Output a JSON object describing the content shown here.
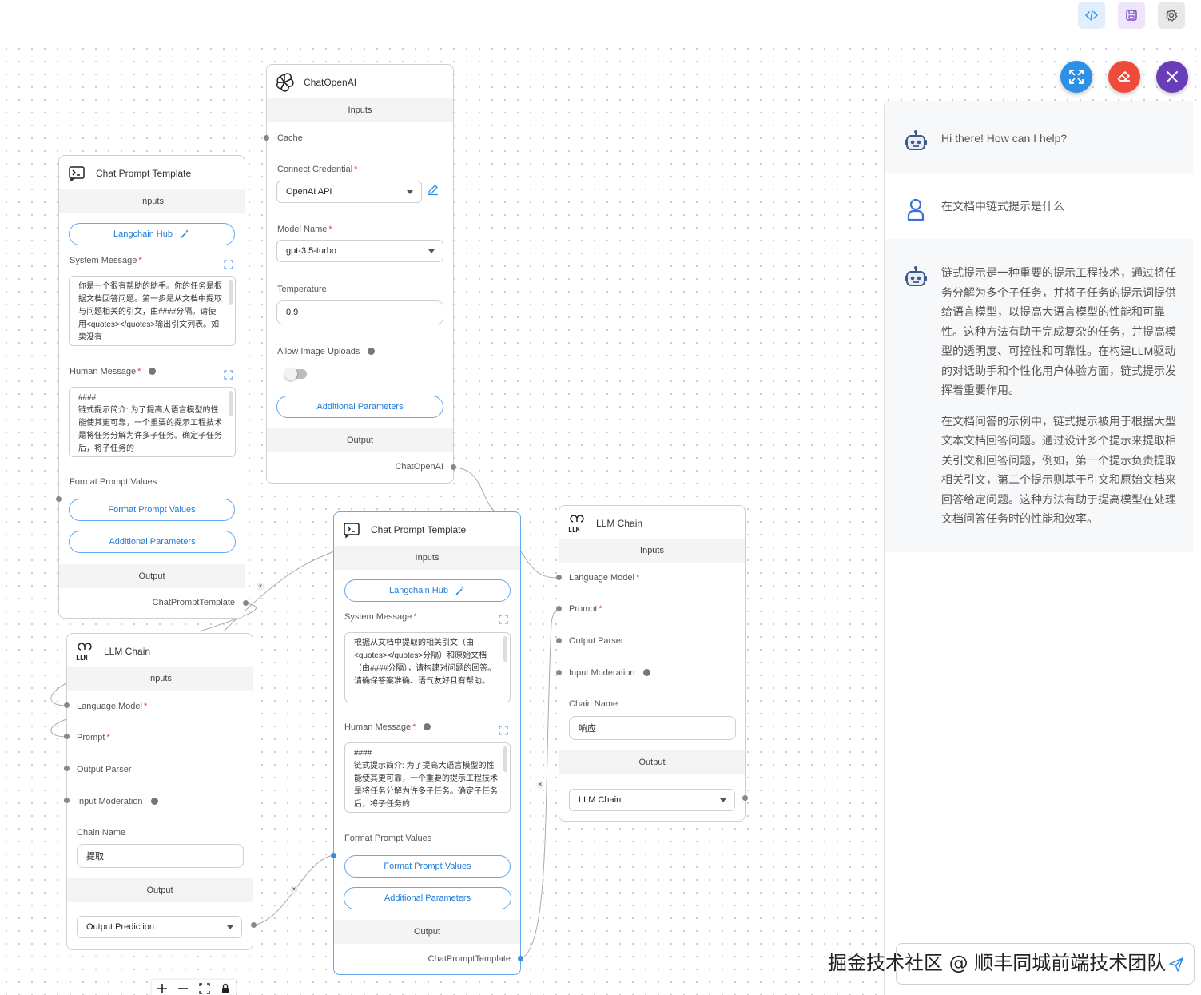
{
  "icons": {
    "code": "code-icon",
    "save": "save-icon",
    "settings": "gear-icon",
    "expand": "expand-icon",
    "eraser": "eraser-icon",
    "close": "close-icon",
    "send": "send-icon"
  },
  "colors": {
    "accent_blue": "#1f7bd6",
    "fab_expand": "#2d8fe6",
    "fab_eraser": "#ef4b3b",
    "fab_close": "#6a3db8",
    "selected_border": "#64a8ee"
  },
  "nodes": {
    "chatopenai": {
      "title": "ChatOpenAI",
      "inputs_label": "Inputs",
      "cache_label": "Cache",
      "credential_label": "Connect Credential",
      "credential_value": "OpenAI API",
      "model_label": "Model Name",
      "model_value": "gpt-3.5-turbo",
      "temperature_label": "Temperature",
      "temperature_value": "0.9",
      "image_uploads_label": "Allow Image Uploads",
      "additional_params": "Additional Parameters",
      "output_label": "Output",
      "output_value": "ChatOpenAI"
    },
    "prompt1": {
      "title": "Chat Prompt Template",
      "inputs_label": "Inputs",
      "hub_label": "Langchain Hub",
      "system_label": "System Message",
      "system_text": "你是一个很有帮助的助手。你的任务是根据文档回答问题。第一步是从文档中提取与问题相关的引文，由####分隔。请使用<quotes></quotes>输出引文列表。如果没有",
      "human_label": "Human Message",
      "human_text": "####\n链式提示简介: 为了提高大语言模型的性能使其更可靠，一个重要的提示工程技术是将任务分解为许多子任务。确定子任务后，将子任务的",
      "format_label": "Format Prompt Values",
      "format_button": "Format Prompt Values",
      "additional_params": "Additional Parameters",
      "output_label": "Output",
      "output_value": "ChatPromptTemplate"
    },
    "prompt2": {
      "title": "Chat Prompt Template",
      "inputs_label": "Inputs",
      "hub_label": "Langchain Hub",
      "system_label": "System Message",
      "system_text": "根据从文档中提取的相关引文（由<quotes></quotes>分隔）和原始文档（由####分隔），请构建对问题的回答。请确保答案准确、语气友好且有帮助。",
      "human_label": "Human Message",
      "human_text": "####\n链式提示简介: 为了提高大语言模型的性能使其更可靠，一个重要的提示工程技术是将任务分解为许多子任务。确定子任务后，将子任务的",
      "format_label": "Format Prompt Values",
      "format_button": "Format Prompt Values",
      "additional_params": "Additional Parameters",
      "output_label": "Output",
      "output_value": "ChatPromptTemplate"
    },
    "chain1": {
      "title": "LLM Chain",
      "inputs_label": "Inputs",
      "language_model_label": "Language Model",
      "prompt_label": "Prompt",
      "output_parser_label": "Output Parser",
      "input_moderation_label": "Input Moderation",
      "chain_name_label": "Chain Name",
      "chain_name_value": "提取",
      "output_label": "Output",
      "output_value": "Output Prediction"
    },
    "chain2": {
      "title": "LLM Chain",
      "inputs_label": "Inputs",
      "language_model_label": "Language Model",
      "prompt_label": "Prompt",
      "output_parser_label": "Output Parser",
      "input_moderation_label": "Input Moderation",
      "chain_name_label": "Chain Name",
      "chain_name_value": "响应",
      "output_label": "Output",
      "output_value": "LLM Chain"
    }
  },
  "edge_delete_glyph": "×",
  "chat": {
    "greeting": "Hi there! How can I help?",
    "user_question": "在文档中链式提示是什么",
    "answer_p1": "链式提示是一种重要的提示工程技术，通过将任务分解为多个子任务，并将子任务的提示词提供给语言模型，以提高大语言模型的性能和可靠性。这种方法有助于完成复杂的任务，并提高模型的透明度、可控性和可靠性。在构建LLM驱动的对话助手和个性化用户体验方面，链式提示发挥着重要作用。",
    "answer_p2": "在文档问答的示例中，链式提示被用于根据大型文本文档回答问题。通过设计多个提示来提取相关引文和回答问题，例如，第一个提示负责提取相关引文，第二个提示则基于引文和原始文档来回答给定问题。这种方法有助于提高模型在处理文档问答任务时的性能和效率。"
  },
  "watermark": "掘金技术社区 @ 顺丰同城前端技术团队"
}
